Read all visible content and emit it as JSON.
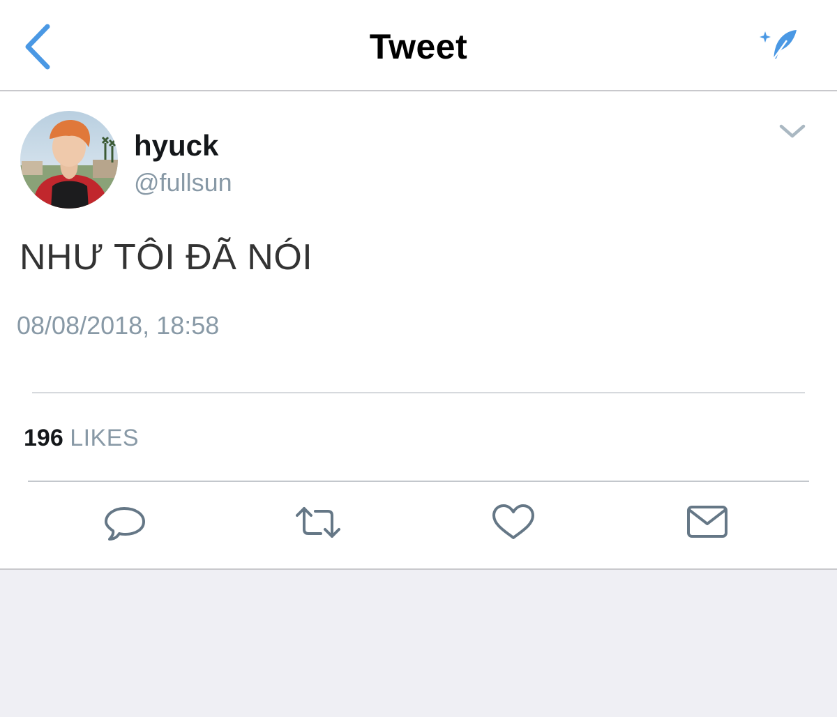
{
  "navbar": {
    "title": "Tweet",
    "back_icon": "chevron-left-icon",
    "compose_icon": "compose-quill-icon",
    "accent_color": "#4a98e4"
  },
  "tweet": {
    "display_name": "hyuck",
    "handle": "@fullsun",
    "text": "NHƯ TÔI ĐÃ NÓI",
    "timestamp": "08/08/2018, 18:58",
    "likes_count": "196",
    "likes_label": "LIKES",
    "menu_icon": "chevron-down-icon"
  },
  "actions": [
    {
      "name": "reply",
      "icon": "reply-bubble-icon"
    },
    {
      "name": "retweet",
      "icon": "retweet-icon"
    },
    {
      "name": "like",
      "icon": "heart-icon"
    },
    {
      "name": "direct-message",
      "icon": "envelope-icon"
    }
  ],
  "colors": {
    "secondary_text": "#8899a6",
    "icon_gray": "#657786",
    "background": "#efeff4"
  }
}
